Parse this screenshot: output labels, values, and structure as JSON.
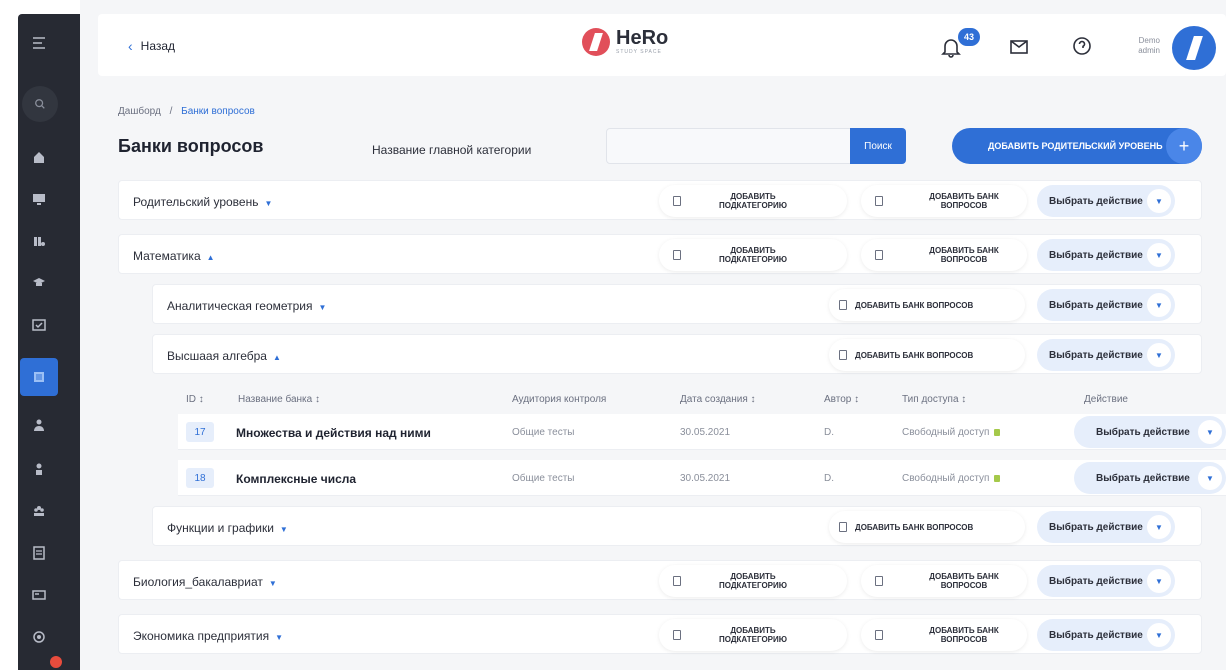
{
  "sidebar": {
    "icons": [
      "menu-icon",
      "search-icon",
      "home-icon",
      "monitor-icon",
      "library-icon",
      "graduation-icon",
      "quiz-icon",
      "question-bank-icon",
      "user-group-icon",
      "user-icon",
      "team-icon",
      "document-icon",
      "card-icon",
      "settings-icon"
    ]
  },
  "topbar": {
    "back_label": "Назад",
    "logo_text": "HeRo",
    "logo_sub": "STUDY SPACE",
    "notification_count": "43",
    "user_name": "Demo",
    "user_role": "admin"
  },
  "breadcrumb": {
    "home": "Дашборд",
    "separator": "/",
    "current": "Банки вопросов"
  },
  "page": {
    "title": "Банки вопросов",
    "filter_label": "Название главной категории",
    "search_value": "",
    "search_button": "Поиск",
    "add_parent_button": "ДОБАВИТЬ РОДИТЕЛЬСКИЙ УРОВЕНЬ"
  },
  "actions": {
    "add_subcategory": "ДОБАВИТЬ ПОДКАТЕГОРИЮ",
    "add_bank": "ДОБАВИТЬ БАНК ВОПРОСОВ",
    "choose": "Выбрать действие"
  },
  "categories": {
    "parent": "Родительский уровень",
    "math": "Математика",
    "analytic": "Аналитическая геометрия",
    "algebra": "Высшаая алгебра",
    "functions": "Функции и графики",
    "biology": "Биология_бакалавриат",
    "economics": "Экономика предприятия"
  },
  "table": {
    "headers": {
      "id": "ID ↕",
      "name": "Название банка ↕",
      "audience": "Аудитория контроля",
      "date": "Дата создания ↕",
      "author": "Автор ↕",
      "access": "Тип доступа ↕",
      "action": "Действие"
    },
    "rows": [
      {
        "id": "17",
        "name": "Множества и действия над ними",
        "audience": "Общие тесты",
        "date": "30.05.2021",
        "author": "D.",
        "access": "Свободный доступ"
      },
      {
        "id": "18",
        "name": "Комплексные числа",
        "audience": "Общие тесты",
        "date": "30.05.2021",
        "author": "D.",
        "access": "Свободный доступ"
      }
    ]
  },
  "colors": {
    "accent": "#2f6fd6",
    "sidebar": "#272a33",
    "brand": "#e14f5a",
    "access_lock": "#a5c94a"
  }
}
